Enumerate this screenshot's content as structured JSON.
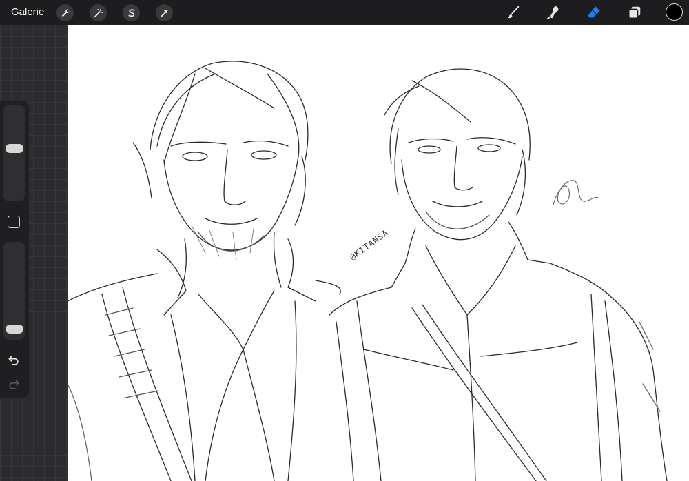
{
  "topbar": {
    "gallery_label": "Galerie",
    "left_tools": [
      {
        "name": "actions",
        "icon": "wrench-icon"
      },
      {
        "name": "adjustments",
        "icon": "magic-wand-icon"
      },
      {
        "name": "selection",
        "icon": "selection-s-icon"
      },
      {
        "name": "transform",
        "icon": "arrow-cursor-icon"
      }
    ],
    "right_tools": [
      {
        "name": "brush",
        "icon": "brush-icon",
        "active": false
      },
      {
        "name": "smudge",
        "icon": "smudge-icon",
        "active": false
      },
      {
        "name": "eraser",
        "icon": "eraser-icon",
        "active": true
      },
      {
        "name": "layers",
        "icon": "layers-icon",
        "active": false
      }
    ],
    "current_color": "#000000",
    "accent_color": "#1e7cf2"
  },
  "sidebar": {
    "brush_size_level": 0.55,
    "opacity_level": 0.05,
    "modify_icon": "square-icon",
    "undo_icon": "undo-arrow-icon",
    "redo_icon": "redo-arrow-icon"
  },
  "canvas": {
    "signature_text": "@KITANSA",
    "background": "#ffffff"
  }
}
